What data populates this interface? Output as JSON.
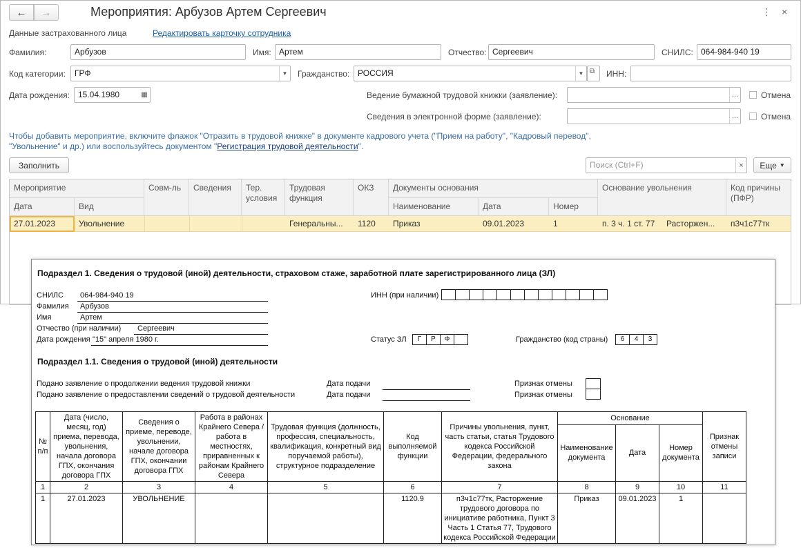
{
  "window": {
    "title": "Мероприятия: Арбузов Артем Сергеевич",
    "back_icon": "←",
    "forward_icon": "→",
    "more_icon": "⋮",
    "close_icon": "×"
  },
  "insured": {
    "section_label": "Данные застрахованного лица",
    "edit_link": "Редактировать карточку сотрудника",
    "surname_label": "Фамилия:",
    "surname": "Арбузов",
    "name_label": "Имя:",
    "name": "Артем",
    "patronymic_label": "Отчество:",
    "patronymic": "Сергеевич",
    "snils_label": "СНИЛС:",
    "snils": "064-984-940 19",
    "category_label": "Код категории:",
    "category": "ГРФ",
    "citizenship_label": "Гражданство:",
    "citizenship": "РОССИЯ",
    "inn_label": "ИНН:",
    "inn": "",
    "birth_label": "Дата рождения:",
    "birth": "15.04.1980",
    "paper_label": "Ведение бумажной трудовой книжки (заявление):",
    "paper_value": "",
    "electronic_label": "Сведения в электронной форме (заявление):",
    "electronic_value": "",
    "cancel_label": "Отмена",
    "cancel_label2": "Отмена"
  },
  "hint": {
    "line1": "Чтобы добавить мероприятие, включите флажок \"Отразить в трудовой книжке\" в документе кадрового учета (\"Прием на работу\", \"Кадровый перевод\",",
    "line2_start": "\"Увольнение\" и др.) или воспользуйтесь документом \"",
    "line2_link": "Регистрация трудовой деятельности",
    "line2_end": "\"."
  },
  "toolbar": {
    "fill_button": "Заполнить",
    "search_placeholder": "Поиск (Ctrl+F)",
    "more_button": "Еще"
  },
  "grid": {
    "headers": {
      "event": "Мероприятие",
      "date": "Дата",
      "kind": "Вид",
      "combo": "Совм-ль",
      "info": "Сведения",
      "terr": "Тер. условия",
      "function": "Трудовая функция",
      "okz": "ОКЗ",
      "docs": "Документы основания",
      "doc_name": "Наименование",
      "doc_date": "Дата",
      "doc_number": "Номер",
      "dismissal": "Основание увольнения",
      "reason_code": "Код причины (ПФР)"
    },
    "rows": [
      {
        "date": "27.01.2023",
        "kind": "Увольнение",
        "combo": "",
        "info": "",
        "terr": "",
        "function": "Генеральны...",
        "okz": "1120",
        "doc_name": "Приказ",
        "doc_date": "09.01.2023",
        "doc_number": "1",
        "dismissal_article": "п. 3 ч. 1 ст. 77",
        "dismissal_text": "Расторжен...",
        "reason_code": "п3ч1с77тк"
      }
    ]
  },
  "form": {
    "section1_title": "Подраздел 1. Сведения о трудовой (иной) деятельности, страховом стаже, заработной плате зарегистрированного лица (ЗЛ)",
    "snils_label": "СНИЛС",
    "snils": "064-984-940 19",
    "surname_label": "Фамилия",
    "surname": "Арбузов",
    "name_label": "Имя",
    "name": "Артем",
    "patronymic_label": "Отчество (при наличии)",
    "patronymic": "Сергеевич",
    "birth_label": "Дата рождения",
    "birth": "\"15\" апреля 1980 г.",
    "inn_label": "ИНН (при наличии)",
    "status_label": "Статус ЗЛ",
    "status_cells": [
      "Г",
      "Р",
      "Ф",
      ""
    ],
    "citizenship_label": "Гражданство (код страны)",
    "citizenship_cells": [
      "6",
      "4",
      "3"
    ],
    "section11_title": "Подраздел 1.1. Сведения о трудовой (иной) деятельности",
    "app1": "Подано заявление о продолжении ведения трудовой книжки",
    "app2": "Подано заявление о предоставлении сведений о трудовой деятельности",
    "submit_date_label": "Дата подачи",
    "cancel_sign_label": "Признак отмены",
    "table": {
      "h_num": "№ п/п",
      "h_date": "Дата (число, месяц, год) приема, перевода, увольнения, начала договора ГПХ, окончания договора ГПХ",
      "h_info": "Сведения о приеме, переводе, увольнении, начале договора ГПХ, окончании договора ГПХ",
      "h_north": "Работа в районах Крайнего Севера / работа в местностях, приравненных к районам Крайнего Севера",
      "h_function": "Трудовая функция (должность, профессия, специальность, квалификация, конкретный вид поручаемой работы), структурное подразделение",
      "h_code": "Код выполняемой функции",
      "h_reason": "Причины увольнения, пункт, часть статьи, статья Трудового кодекса Российской Федерации, федерального закона",
      "h_basis": "Основание",
      "h_docname": "Наименование документа",
      "h_docdate": "Дата",
      "h_docnum": "Номер документа",
      "h_cancel": "Признак отмены записи",
      "col_numbers": [
        "1",
        "2",
        "3",
        "4",
        "5",
        "6",
        "7",
        "8",
        "9",
        "10",
        "11"
      ],
      "rows": [
        {
          "num": "1",
          "date": "27.01.2023",
          "info": "УВОЛЬНЕНИЕ",
          "north": "",
          "function": "",
          "code": "1120.9",
          "reason": "п3ч1с77тк, Расторжение трудового договора по инициативе работника, Пункт 3 Часть 1 Статья 77, Трудового кодекса Российской Федерации",
          "docname": "Приказ",
          "docdate": "09.01.2023",
          "docnum": "1",
          "cancel": ""
        }
      ]
    }
  }
}
